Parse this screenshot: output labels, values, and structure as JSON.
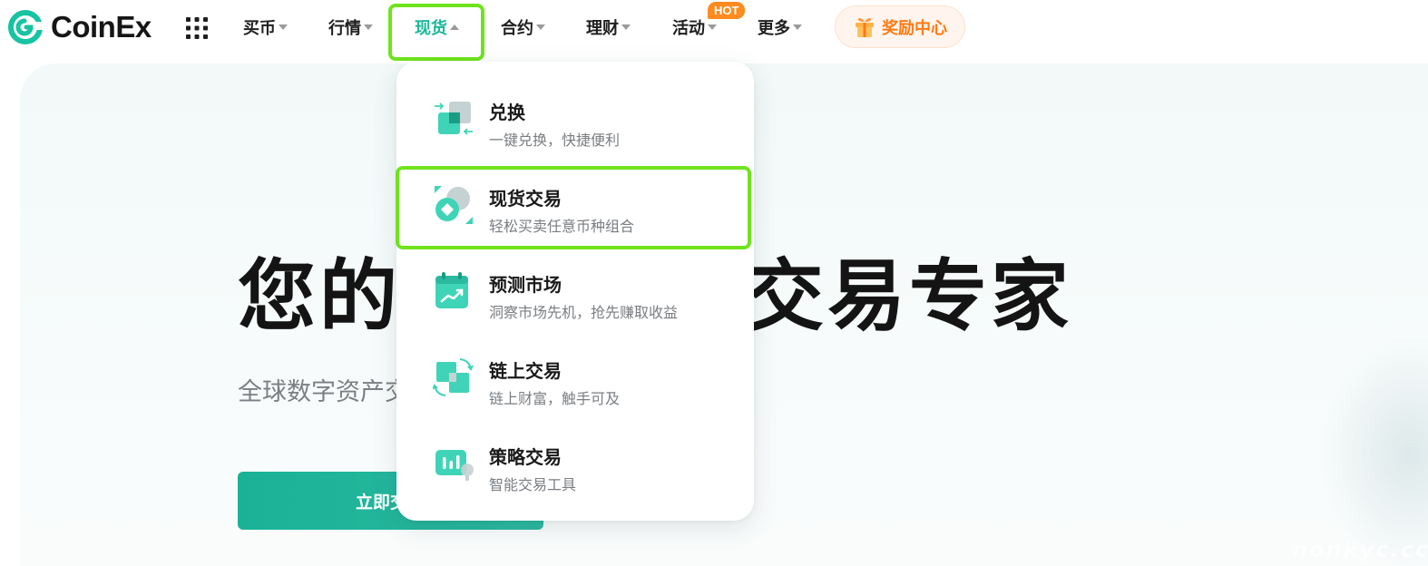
{
  "brand": {
    "name": "CoinEx",
    "accent_color": "#1bb89a",
    "logo_icon": "coinex-logo-icon"
  },
  "nav": {
    "apps_icon": "grid-icon",
    "items": [
      {
        "label": "买币",
        "expanded": false
      },
      {
        "label": "行情",
        "expanded": false
      },
      {
        "label": "现货",
        "expanded": true,
        "active": true
      },
      {
        "label": "合约",
        "expanded": false
      },
      {
        "label": "理财",
        "expanded": false
      },
      {
        "label": "活动",
        "expanded": false,
        "badge": "HOT"
      },
      {
        "label": "更多",
        "expanded": false
      }
    ],
    "reward_button": {
      "label": "奖励中心",
      "icon": "gift-icon",
      "color": "#ff7a14"
    },
    "highlight_color": "#6fe41c"
  },
  "dropdown": {
    "items": [
      {
        "title": "兑换",
        "desc": "一键兑换，快捷便利",
        "icon": "swap-icon"
      },
      {
        "title": "现货交易",
        "desc": "轻松买卖任意币种组合",
        "icon": "spot-trade-icon",
        "highlighted": true
      },
      {
        "title": "预测市场",
        "desc": "洞察市场先机，抢先赚取收益",
        "icon": "calendar-chart-icon"
      },
      {
        "title": "链上交易",
        "desc": "链上财富，触手可及",
        "icon": "onchain-icon"
      },
      {
        "title": "策略交易",
        "desc": "智能交易工具",
        "icon": "strategy-bars-icon"
      }
    ]
  },
  "hero": {
    "title_left": "您的",
    "title_right": "交易专家",
    "subtitle": "全球数字资产交",
    "cta_label": "立即交"
  },
  "watermark": "nonkyc.cc"
}
